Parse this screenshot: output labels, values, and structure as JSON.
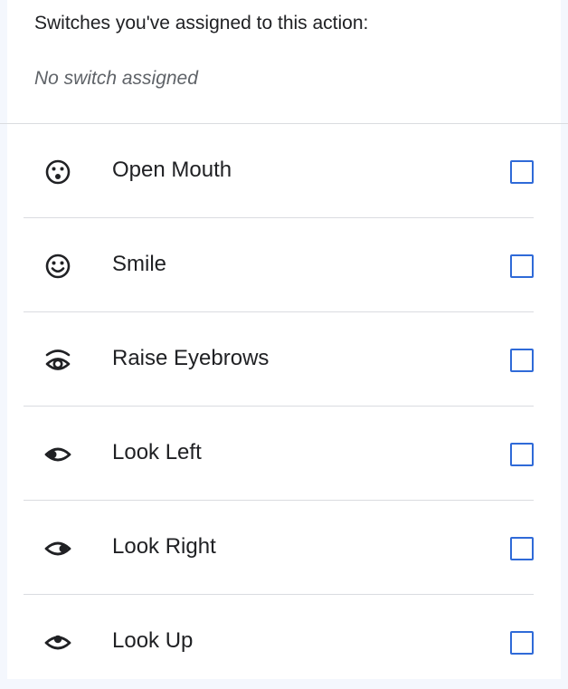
{
  "header": {
    "title": "Switches you've assigned to this action:",
    "empty_text": "No switch assigned"
  },
  "gestures": [
    {
      "label": "Open Mouth",
      "icon": "open-mouth-face-icon",
      "checked": false
    },
    {
      "label": "Smile",
      "icon": "smile-face-icon",
      "checked": false
    },
    {
      "label": "Raise Eyebrows",
      "icon": "raise-eyebrows-icon",
      "checked": false
    },
    {
      "label": "Look Left",
      "icon": "look-left-eye-icon",
      "checked": false
    },
    {
      "label": "Look Right",
      "icon": "look-right-eye-icon",
      "checked": false
    },
    {
      "label": "Look Up",
      "icon": "look-up-eye-icon",
      "checked": false
    }
  ],
  "colors": {
    "checkbox_accent": "#2f6ad8",
    "text_primary": "#202124",
    "text_secondary": "#5f6368",
    "divider": "#dadce0"
  }
}
